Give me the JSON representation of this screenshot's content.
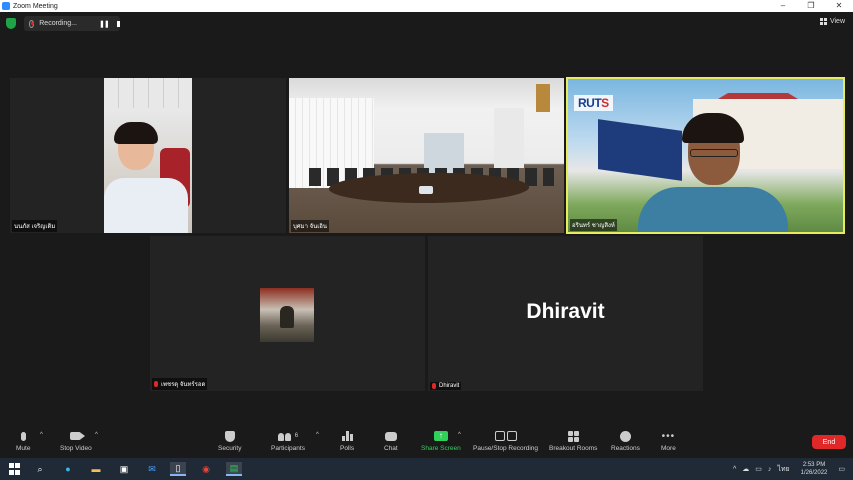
{
  "window": {
    "title": "Zoom Meeting",
    "minimize": "–",
    "maximize": "❐",
    "close": "✕"
  },
  "recording": {
    "label": "Recording..."
  },
  "view": {
    "label": "View"
  },
  "participants": [
    {
      "name": "นนภัส เจริญเดิม"
    },
    {
      "name": "บุศมา จันเอิน"
    },
    {
      "name": "อรินทร์ ชาญสิงห์"
    },
    {
      "name": "เพชรดุ จันทร์รอด"
    },
    {
      "name": "Dhiravit",
      "display": "Dhiravit"
    }
  ],
  "toolbar": {
    "mute": "Mute",
    "stop_video": "Stop Video",
    "security": "Security",
    "participants": "Participants",
    "participant_count": "6",
    "polls": "Polls",
    "chat": "Chat",
    "share_screen": "Share Screen",
    "pause_stop_recording": "Pause/Stop Recording",
    "breakout_rooms": "Breakout Rooms",
    "reactions": "Reactions",
    "more": "More",
    "end": "End"
  },
  "rutslogo": {
    "prefix": "RUT",
    "suffix": "S"
  },
  "taskbar": {
    "time": "2:53 PM",
    "date": "1/26/2022",
    "language": "ไทย"
  },
  "colors": {
    "active_speaker_border": "#e6ec5b",
    "share_green": "#2fd15a",
    "end_red": "#e02828"
  }
}
